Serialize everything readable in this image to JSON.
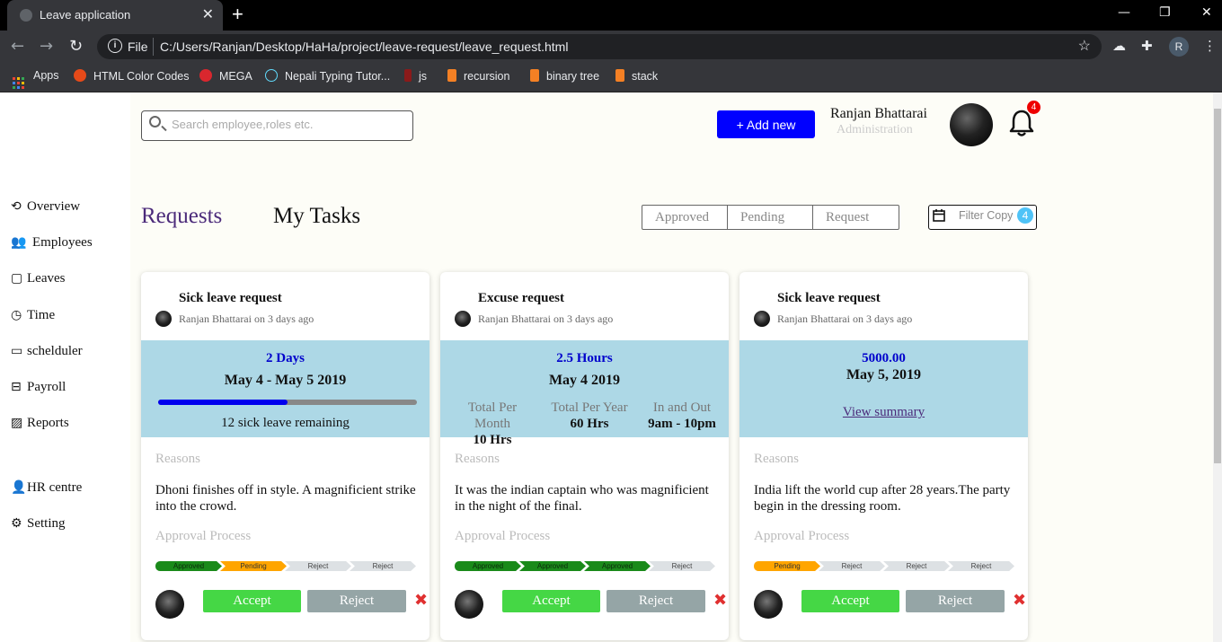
{
  "browser": {
    "tab_title": "Leave application",
    "url_scheme": "File",
    "url": "C:/Users/Ranjan/Desktop/HaHa/project/leave-request/leave_request.html",
    "profile_initial": "R",
    "bookmarks": [
      "Apps",
      "HTML Color Codes",
      "MEGA",
      "Nepali Typing Tutor...",
      "js",
      "recursion",
      "binary tree",
      "stack"
    ]
  },
  "search": {
    "placeholder": "Search employee,roles etc."
  },
  "header": {
    "add_label": "+ Add new",
    "user_name": "Ranjan Bhattarai",
    "user_role": "Administration",
    "notification_count": "4"
  },
  "sidebar": {
    "items": [
      "Overview",
      "Employees",
      "Leaves",
      "Time",
      "schelduler",
      "Payroll",
      "Reports",
      "HR centre",
      "Setting"
    ]
  },
  "tabs": {
    "requests": "Requests",
    "my_tasks": "My Tasks"
  },
  "segments": [
    "Approved",
    "Pending",
    "Request"
  ],
  "filter": {
    "label": "Filter Copy",
    "count": "4"
  },
  "labels": {
    "reasons": "Reasons",
    "approval": "Approval Process",
    "accept": "Accept",
    "reject": "Reject"
  },
  "cards": [
    {
      "title": "Sick leave request",
      "by": "Ranjan Bhattarai on 3 days ago",
      "duration": "2 Days",
      "date": "May 4 - May 5 2019",
      "progress": 0.5,
      "remaining": "12 sick leave remaining",
      "reason": "Dhoni finishes off in style. A magnificient strike into the crowd.",
      "steps": [
        {
          "label": "Approved",
          "state": "approved"
        },
        {
          "label": "Pending",
          "state": "pending"
        },
        {
          "label": "Reject",
          "state": "reject"
        },
        {
          "label": "Reject",
          "state": "reject"
        }
      ]
    },
    {
      "title": "Excuse request",
      "by": "Ranjan Bhattarai on 3 days ago",
      "duration": "2.5 Hours",
      "date": "May 4 2019",
      "stats": [
        {
          "label": "Total Per Month",
          "value": "10 Hrs"
        },
        {
          "label": "Total Per Year",
          "value": "60 Hrs"
        },
        {
          "label": "In and Out",
          "value": "9am - 10pm"
        }
      ],
      "reason": "It was the indian captain who was magnificient in the night of the final.",
      "steps": [
        {
          "label": "Approved",
          "state": "approved"
        },
        {
          "label": "Approved",
          "state": "approved"
        },
        {
          "label": "Approved",
          "state": "approved"
        },
        {
          "label": "Reject",
          "state": "reject"
        }
      ]
    },
    {
      "title": "Sick leave request",
      "by": "Ranjan Bhattarai on 3 days ago",
      "duration": "5000.00",
      "date": "May 5, 2019",
      "link": "View summary",
      "reason": "India lift the world cup after 28 years.The party begin in the dressing room.",
      "steps": [
        {
          "label": "Pending",
          "state": "pending"
        },
        {
          "label": "Reject",
          "state": "reject"
        },
        {
          "label": "Reject",
          "state": "reject"
        },
        {
          "label": "Reject",
          "state": "reject"
        }
      ]
    }
  ],
  "colors": {
    "primary": "#0000ff",
    "accept": "#45d745",
    "reject": "#95a5a6",
    "band": "#add8e6",
    "purple": "#4b2a7a"
  }
}
